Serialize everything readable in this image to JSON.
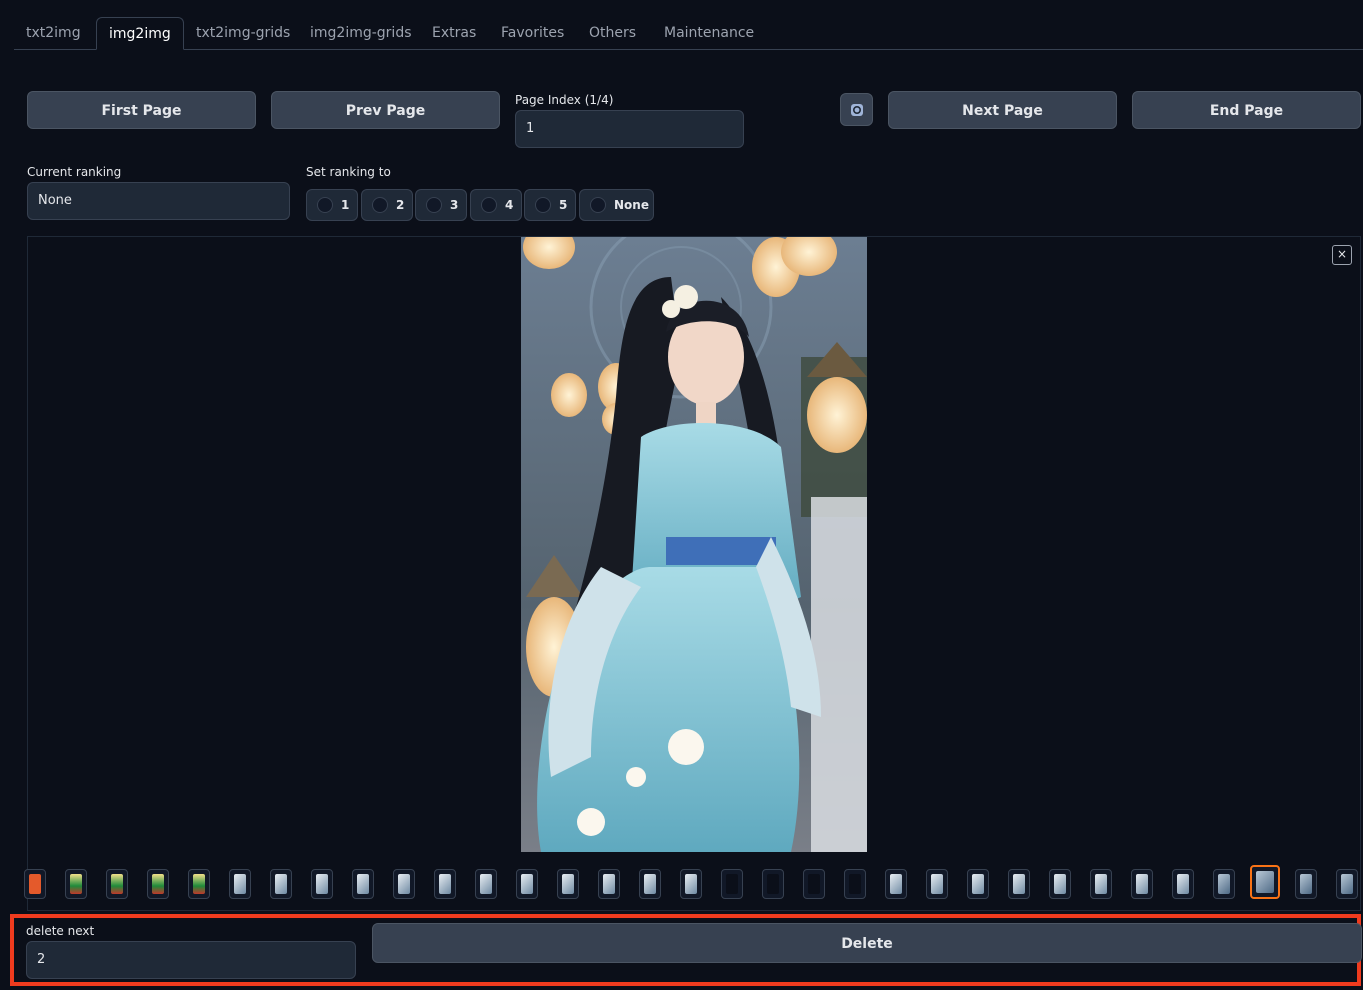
{
  "tabs": [
    "txt2img",
    "img2img",
    "txt2img-grids",
    "img2img-grids",
    "Extras",
    "Favorites",
    "Others",
    "Maintenance"
  ],
  "active_tab": "img2img",
  "nav": {
    "first_label": "First Page",
    "prev_label": "Prev Page",
    "page_index_label": "Page Index (1/4)",
    "page_index_value": "1",
    "next_label": "Next Page",
    "end_label": "End Page",
    "refresh_icon": "refresh-icon"
  },
  "ranking": {
    "current_label": "Current ranking",
    "current_value": "None",
    "set_label": "Set ranking to",
    "options": [
      "1",
      "2",
      "3",
      "4",
      "5",
      "None"
    ]
  },
  "gallery": {
    "close_symbol": "×",
    "selected_thumb_index": 30
  },
  "delete": {
    "next_label": "delete next",
    "next_value": "2",
    "button_label": "Delete"
  },
  "colors": {
    "background": "#0b0f19",
    "button": "#374151",
    "highlight_border": "#ef3b1e",
    "selected_thumb": "#f97316"
  }
}
